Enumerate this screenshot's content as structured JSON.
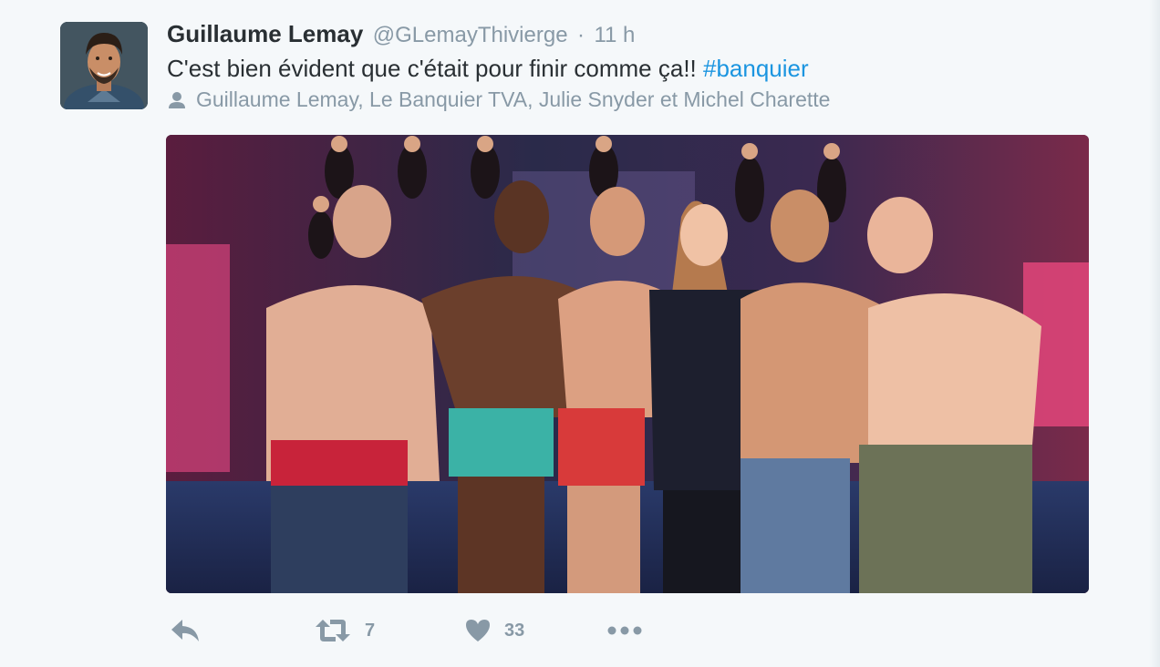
{
  "tweet": {
    "author": {
      "name": "Guillaume Lemay",
      "handle": "@GLemayThivierge",
      "separator": "·",
      "time": "11 h"
    },
    "text": {
      "body": "C'est bien évident que c'était pour finir comme ça!! ",
      "hashtag": "#banquier"
    },
    "tagged": "Guillaume Lemay, Le Banquier TVA, Julie Snyder et Michel Charette",
    "actions": {
      "reply_icon": "reply-icon",
      "retweet_icon": "retweet-icon",
      "retweet_count": "7",
      "like_icon": "heart-icon",
      "like_count": "33",
      "more_icon": "more-icon"
    }
  },
  "colors": {
    "background": "#f5f8fa",
    "text": "#292f33",
    "secondary": "#8899a6",
    "hashtag": "#1b95e0"
  }
}
